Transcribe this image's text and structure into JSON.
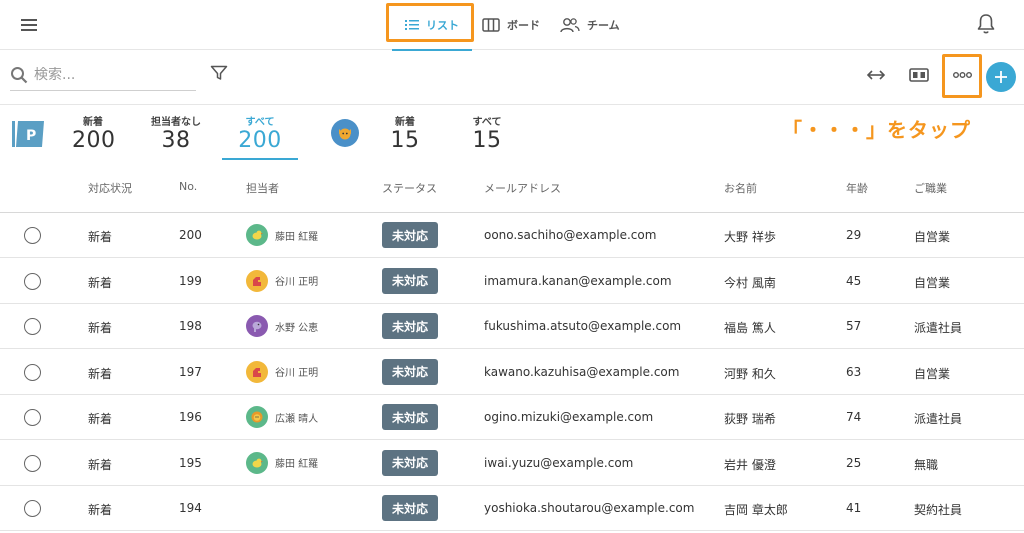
{
  "nav": {
    "tabs": [
      {
        "label": "リスト",
        "icon": "list-icon",
        "active": true
      },
      {
        "label": "ボード",
        "icon": "board-icon",
        "active": false
      },
      {
        "label": "チーム",
        "icon": "team-icon",
        "active": false
      }
    ]
  },
  "search": {
    "placeholder": "検索..."
  },
  "summary": {
    "own": [
      {
        "label": "新着",
        "value": "200"
      },
      {
        "label": "担当者なし",
        "value": "38"
      },
      {
        "label": "すべて",
        "value": "200"
      }
    ],
    "team": [
      {
        "label": "新着",
        "value": "15"
      },
      {
        "label": "すべて",
        "value": "15"
      }
    ]
  },
  "annotation": "「・・・」をタップ",
  "table": {
    "headers": [
      "対応状況",
      "No.",
      "担当者",
      "ステータス",
      "メールアドレス",
      "お名前",
      "年齢",
      "ご職業"
    ],
    "rows": [
      {
        "state": "新着",
        "no": "200",
        "assignee": "藤田 紅羅",
        "avatar": "bird",
        "status": "未対応",
        "email": "oono.sachiho@example.com",
        "name": "大野 祥歩",
        "age": "29",
        "job": "自営業"
      },
      {
        "state": "新着",
        "no": "199",
        "assignee": "谷川 正明",
        "avatar": "dino",
        "status": "未対応",
        "email": "imamura.kanan@example.com",
        "name": "今村 風南",
        "age": "45",
        "job": "自営業"
      },
      {
        "state": "新着",
        "no": "198",
        "assignee": "水野 公恵",
        "avatar": "elephant",
        "status": "未対応",
        "email": "fukushima.atsuto@example.com",
        "name": "福島 篤人",
        "age": "57",
        "job": "派遣社員"
      },
      {
        "state": "新着",
        "no": "197",
        "assignee": "谷川 正明",
        "avatar": "dino",
        "status": "未対応",
        "email": "kawano.kazuhisa@example.com",
        "name": "河野 和久",
        "age": "63",
        "job": "自営業"
      },
      {
        "state": "新着",
        "no": "196",
        "assignee": "広瀬 晴人",
        "avatar": "lion",
        "status": "未対応",
        "email": "ogino.mizuki@example.com",
        "name": "荻野 瑞希",
        "age": "74",
        "job": "派遣社員"
      },
      {
        "state": "新着",
        "no": "195",
        "assignee": "藤田 紅羅",
        "avatar": "bird",
        "status": "未対応",
        "email": "iwai.yuzu@example.com",
        "name": "岩井 優澄",
        "age": "25",
        "job": "無職"
      },
      {
        "state": "新着",
        "no": "194",
        "assignee": "",
        "avatar": "",
        "status": "未対応",
        "email": "yoshioka.shoutarou@example.com",
        "name": "吉岡 章太郎",
        "age": "41",
        "job": "契約社員"
      }
    ]
  },
  "colors": {
    "accent": "#3aa8d4",
    "highlight": "#f5961e",
    "badge": "#5d7382"
  }
}
